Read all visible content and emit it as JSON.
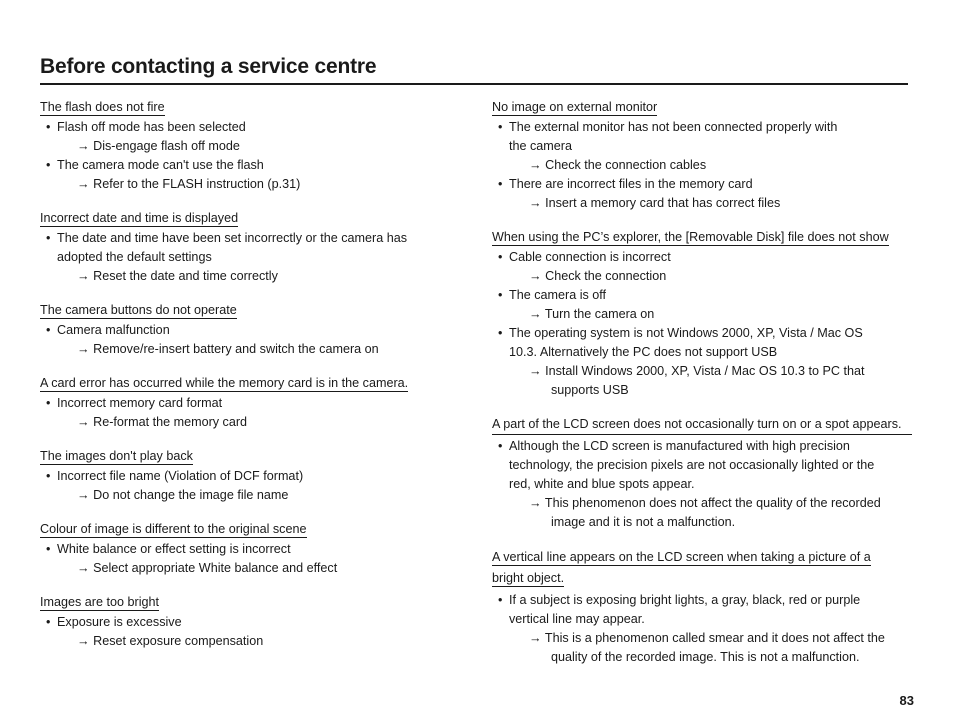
{
  "document": {
    "title": "Before contacting a service centre",
    "page_number": "83"
  },
  "left_column": [
    {
      "heading": "The flash does not fire",
      "heading_rule": "text",
      "items": [
        {
          "bullet": "•",
          "cause": "Flash off mode has been selected",
          "arrow": "→",
          "fix": "Dis-engage flash off mode"
        },
        {
          "bullet": "•",
          "cause": "The camera mode can't use the flash",
          "arrow": "→",
          "fix": "Refer to the FLASH instruction (p.31)"
        }
      ]
    },
    {
      "heading": "Incorrect date and time is displayed",
      "heading_rule": "text",
      "items": [
        {
          "bullet": "•",
          "cause": "The date and time have been set incorrectly or the camera has",
          "cause_line2": "adopted the default settings",
          "arrow": "→",
          "fix": "Reset the date and time correctly"
        }
      ]
    },
    {
      "heading": "The camera buttons do not operate",
      "heading_rule": "text",
      "items": [
        {
          "bullet": "•",
          "cause": "Camera malfunction",
          "arrow": "→",
          "fix": "Remove/re-insert battery and switch the camera on"
        }
      ]
    },
    {
      "heading": "A card error has occurred while the memory card is in the camera.",
      "heading_rule": "text",
      "items": [
        {
          "bullet": "•",
          "cause": "Incorrect memory card format",
          "arrow": "→",
          "fix": "Re-format the memory card"
        }
      ]
    },
    {
      "heading": "The images don't play back",
      "heading_rule": "text",
      "items": [
        {
          "bullet": "•",
          "cause": "Incorrect file name (Violation of DCF format)",
          "arrow": "→",
          "fix": "Do not change the image file name"
        }
      ]
    },
    {
      "heading": "Colour of image is different to the original scene",
      "heading_rule": "text",
      "items": [
        {
          "bullet": "•",
          "cause": "White balance or effect setting is incorrect",
          "arrow": "→",
          "fix": "Select appropriate White balance and effect"
        }
      ]
    },
    {
      "heading": "Images are too bright",
      "heading_rule": "text",
      "items": [
        {
          "bullet": "•",
          "cause": "Exposure is excessive",
          "arrow": "→",
          "fix": "Reset exposure compensation"
        }
      ]
    }
  ],
  "right_column": [
    {
      "heading": "No image on external monitor",
      "heading_rule": "text",
      "items": [
        {
          "bullet": "•",
          "cause": "The external monitor has not been connected properly with",
          "cause_line2": "the camera",
          "arrow": "→",
          "fix": "Check the connection cables"
        },
        {
          "bullet": "•",
          "cause": "There are incorrect files in the memory card",
          "arrow": "→",
          "fix": "Insert a memory card that has correct files"
        }
      ]
    },
    {
      "heading": "When using the PC’s explorer, the [Removable Disk] file does not show",
      "heading_rule": "text",
      "items": [
        {
          "bullet": "•",
          "cause": "Cable connection is incorrect",
          "arrow": "→",
          "fix": "Check the connection"
        },
        {
          "bullet": "•",
          "cause": "The camera is off",
          "arrow": "→",
          "fix": "Turn the camera on"
        },
        {
          "bullet": "•",
          "cause": "The operating system is not Windows 2000, XP, Vista / Mac OS",
          "cause_line2": "10.3. Alternatively the PC does not support USB",
          "arrow": "→",
          "fix": "Install Windows 2000, XP, Vista / Mac OS 10.3 to PC that",
          "fix_line2": "supports USB"
        }
      ]
    },
    {
      "heading": "A part of the LCD screen does not occasionally turn on or a spot appears.",
      "heading_rule": "full",
      "items": [
        {
          "bullet": "•",
          "cause": "Although the LCD screen is manufactured with high precision",
          "cause_line2": "technology, the precision pixels are not occasionally lighted or the",
          "cause_line3": "red, white and blue spots appear.",
          "arrow": "→",
          "fix": "This phenomenon does not affect the quality of the recorded",
          "fix_line2": "image and it is not a malfunction."
        }
      ]
    },
    {
      "heading": "A vertical line appears on the LCD screen when taking a picture of a",
      "heading_line2": "bright object.",
      "heading_rule": "two-line",
      "items": [
        {
          "bullet": "•",
          "cause": "If a subject is exposing bright lights, a gray, black, red or purple",
          "cause_line2": "vertical line may appear.",
          "arrow": "→",
          "fix": "This is a phenomenon called smear and it does not affect the",
          "fix_line2": "quality of the recorded image. This is not a malfunction."
        }
      ]
    }
  ]
}
